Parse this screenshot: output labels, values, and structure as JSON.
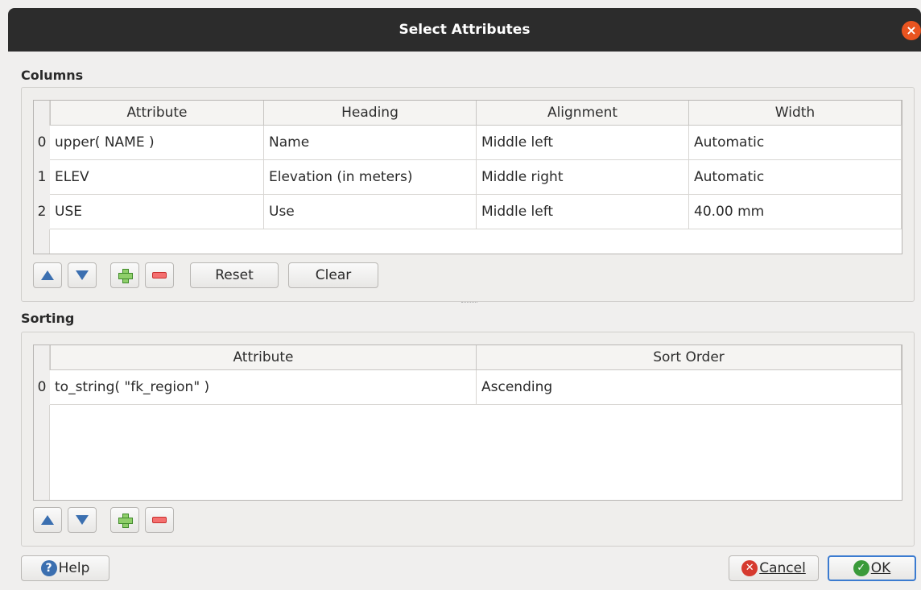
{
  "window": {
    "title": "Select Attributes",
    "close_glyph": "×"
  },
  "columns_group": {
    "title": "Columns",
    "headers": [
      "Attribute",
      "Heading",
      "Alignment",
      "Width"
    ],
    "rows": [
      {
        "num": "0",
        "attribute": "upper( NAME )",
        "heading": "Name",
        "alignment": "Middle left",
        "width": "Automatic"
      },
      {
        "num": "1",
        "attribute": "ELEV",
        "heading": "Elevation (in meters)",
        "alignment": "Middle right",
        "width": "Automatic"
      },
      {
        "num": "2",
        "attribute": "USE",
        "heading": "Use",
        "alignment": "Middle left",
        "width": "40.00 mm"
      }
    ],
    "reset_label": "Reset",
    "clear_label": "Clear"
  },
  "sorting_group": {
    "title": "Sorting",
    "headers": [
      "Attribute",
      "Sort Order"
    ],
    "rows": [
      {
        "num": "0",
        "attribute": "to_string( \"fk_region\" )",
        "sort_order": "Ascending"
      }
    ]
  },
  "footer": {
    "help_label": "Help",
    "cancel_label": "Cancel",
    "ok_label": "OK"
  },
  "icons": {
    "move_up": "arrow-up-icon",
    "move_down": "arrow-down-icon",
    "add": "plus-icon",
    "remove": "minus-icon"
  },
  "colors": {
    "titlebar": "#2c2c2c",
    "close": "#e95420",
    "accent": "#3b7bd0"
  }
}
